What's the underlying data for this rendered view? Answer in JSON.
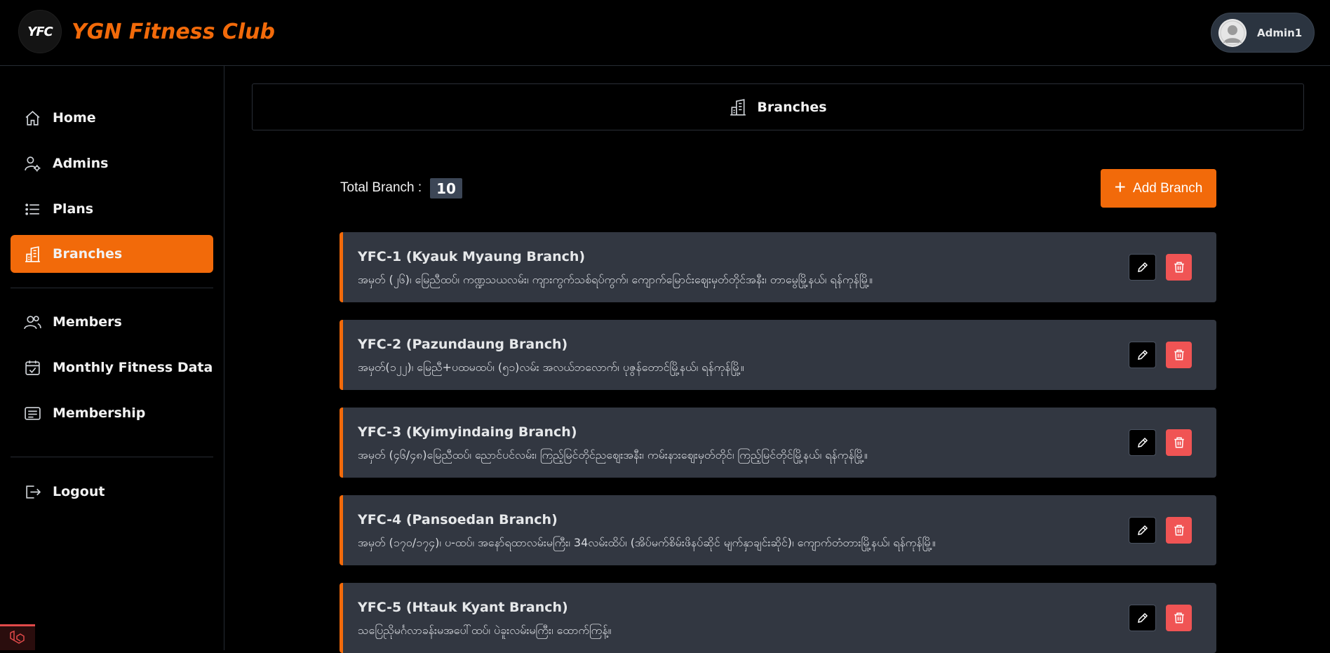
{
  "app": {
    "logo_text": "YFC",
    "title": "YGN Fitness Club",
    "user_name": "Admin1"
  },
  "sidebar": {
    "items": [
      {
        "label": "Home",
        "icon": "home-icon"
      },
      {
        "label": "Admins",
        "icon": "user-gear-icon"
      },
      {
        "label": "Plans",
        "icon": "list-icon"
      },
      {
        "label": "Branches",
        "icon": "building-icon",
        "active": true
      },
      {
        "label": "Members",
        "icon": "users-icon"
      },
      {
        "label": "Monthly Fitness Data",
        "icon": "calendar-check-icon"
      },
      {
        "label": "Membership",
        "icon": "id-card-icon"
      },
      {
        "label": "Logout",
        "icon": "logout-icon"
      }
    ]
  },
  "page": {
    "header": "Branches",
    "total_label": "Total Branch :",
    "total_count": "10",
    "add_button": "Add Branch"
  },
  "branches": [
    {
      "name": "YFC-1 (Kyauk Myaung Branch)",
      "address": "အမှတ် (၂၆)၊ မြေညီထပ်၊ ကဏ္ဍသယလမ်း၊ ကျားကွက်သစ်ရပ်ကွက်၊ ကျောက်မြောင်းဈေးမှတ်တိုင်အနီး၊ တာမွေမြို့နယ်၊ ရန်ကုန်မြို့။"
    },
    {
      "name": "YFC-2 (Pazundaung Branch)",
      "address": "အမှတ်(၁၂၂)၊ မြေညီ+ပထမထပ်၊ (၅၁)လမ်း အလယ်ဘလောက်၊ ပုဇွန်တောင်မြို့နယ်၊ ရန်ကုန်မြို့။"
    },
    {
      "name": "YFC-3 (Kyimyindaing Branch)",
      "address": "အမှတ် (၄၆/၄၈)မြေညီထပ်၊ ညောင်ပင်လမ်း၊ ကြည့်မြင်တိုင်ညဈေးအနီး၊ ကမ်းနားဈေးမှတ်တိုင်၊ ကြည့်မြင်တိုင်မြို့နယ်၊ ရန်ကုန်မြို့။"
    },
    {
      "name": "YFC-4 (Pansoedan Branch)",
      "address": "အမှတ် (၁၇၀/၁၇၄)၊ ပ-ထပ်၊ အနော်ရထာလမ်းမကြီး၊ 34လမ်းထိပ်၊ (အိပ်မက်စိမ်းဖိနပ်ဆိုင် မျက်နှာချင်းဆိုင်)၊ ကျောက်တံတားမြို့နယ်၊ ရန်ကုန်မြို့။"
    },
    {
      "name": "YFC-5 (Htauk Kyant Branch)",
      "address": "သပြေညိုမင်္ဂလာခန်းမအပေါ်ထပ်၊ ပဲခူးလမ်းမကြီး၊ ထောက်ကြန့်။"
    }
  ],
  "colors": {
    "accent": "#f26a0a",
    "card_bg": "#323741",
    "danger": "#f05454",
    "badge_bg": "#3c4656"
  }
}
